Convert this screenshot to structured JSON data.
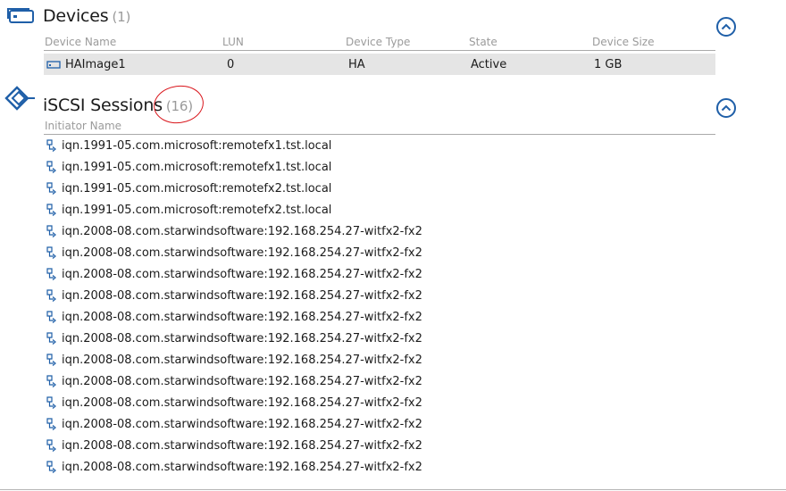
{
  "devices": {
    "title": "Devices",
    "count": "(1)",
    "columns": [
      "Device Name",
      "LUN",
      "Device Type",
      "State",
      "Device Size"
    ],
    "rows": [
      {
        "name": "HAImage1",
        "lun": "0",
        "type": "HA",
        "state": "Active",
        "size": "1 GB"
      }
    ]
  },
  "sessions": {
    "title": "iSCSI Sessions",
    "count": "(16)",
    "column": "Initiator Name",
    "items": [
      "iqn.1991-05.com.microsoft:remotefx1.tst.local",
      "iqn.1991-05.com.microsoft:remotefx1.tst.local",
      "iqn.1991-05.com.microsoft:remotefx2.tst.local",
      "iqn.1991-05.com.microsoft:remotefx2.tst.local",
      "iqn.2008-08.com.starwindsoftware:192.168.254.27-witfx2-fx2",
      "iqn.2008-08.com.starwindsoftware:192.168.254.27-witfx2-fx2",
      "iqn.2008-08.com.starwindsoftware:192.168.254.27-witfx2-fx2",
      "iqn.2008-08.com.starwindsoftware:192.168.254.27-witfx2-fx2",
      "iqn.2008-08.com.starwindsoftware:192.168.254.27-witfx2-fx2",
      "iqn.2008-08.com.starwindsoftware:192.168.254.27-witfx2-fx2",
      "iqn.2008-08.com.starwindsoftware:192.168.254.27-witfx2-fx2",
      "iqn.2008-08.com.starwindsoftware:192.168.254.27-witfx2-fx2",
      "iqn.2008-08.com.starwindsoftware:192.168.254.27-witfx2-fx2",
      "iqn.2008-08.com.starwindsoftware:192.168.254.27-witfx2-fx2",
      "iqn.2008-08.com.starwindsoftware:192.168.254.27-witfx2-fx2",
      "iqn.2008-08.com.starwindsoftware:192.168.254.27-witfx2-fx2"
    ]
  },
  "icons": {
    "devices": "devices-icon",
    "sessions": "iscsi-sessions-icon",
    "device_row": "device-icon",
    "session_row": "session-link-icon",
    "collapse": "chevron-up-icon"
  },
  "colors": {
    "accent": "#1f5fa8",
    "annotation": "#d9141a",
    "row_highlight": "#e5e5e5"
  }
}
